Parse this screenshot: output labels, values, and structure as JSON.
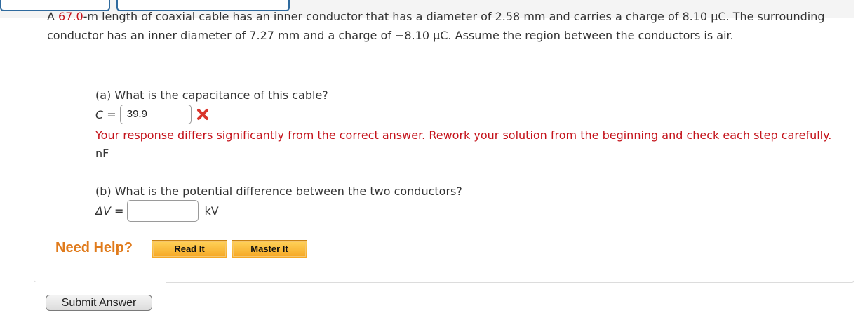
{
  "problem": {
    "text_before": "A ",
    "length_value": "67.0",
    "text_after": "-m length of coaxial cable has an inner conductor that has a diameter of 2.58 mm and carries a charge of 8.10 μC. The surrounding conductor has an inner diameter of 7.27 mm and a charge of −8.10 μC. Assume the region between the conductors is air."
  },
  "part_a": {
    "question": "(a) What is the capacitance of this cable?",
    "var_label": "C",
    "equals": " = ",
    "answer": "39.9",
    "status": "incorrect",
    "status_icon": "x-mark-icon",
    "feedback": "Your response differs significantly from the correct answer. Rework your solution from the beginning and check each step carefully.",
    "unit": "nF"
  },
  "part_b": {
    "question": "(b) What is the potential difference between the two conductors?",
    "var_label": "ΔV",
    "equals": " = ",
    "answer": "",
    "unit": "kV"
  },
  "help": {
    "label": "Need Help?",
    "read_it": "Read It",
    "master_it": "Master It"
  },
  "submit": {
    "label": "Submit Answer"
  },
  "colors": {
    "error_red": "#c4121a",
    "help_orange": "#e07b1c",
    "button_gold": "#f5a623",
    "tab_blue": "#2f6a9e"
  }
}
